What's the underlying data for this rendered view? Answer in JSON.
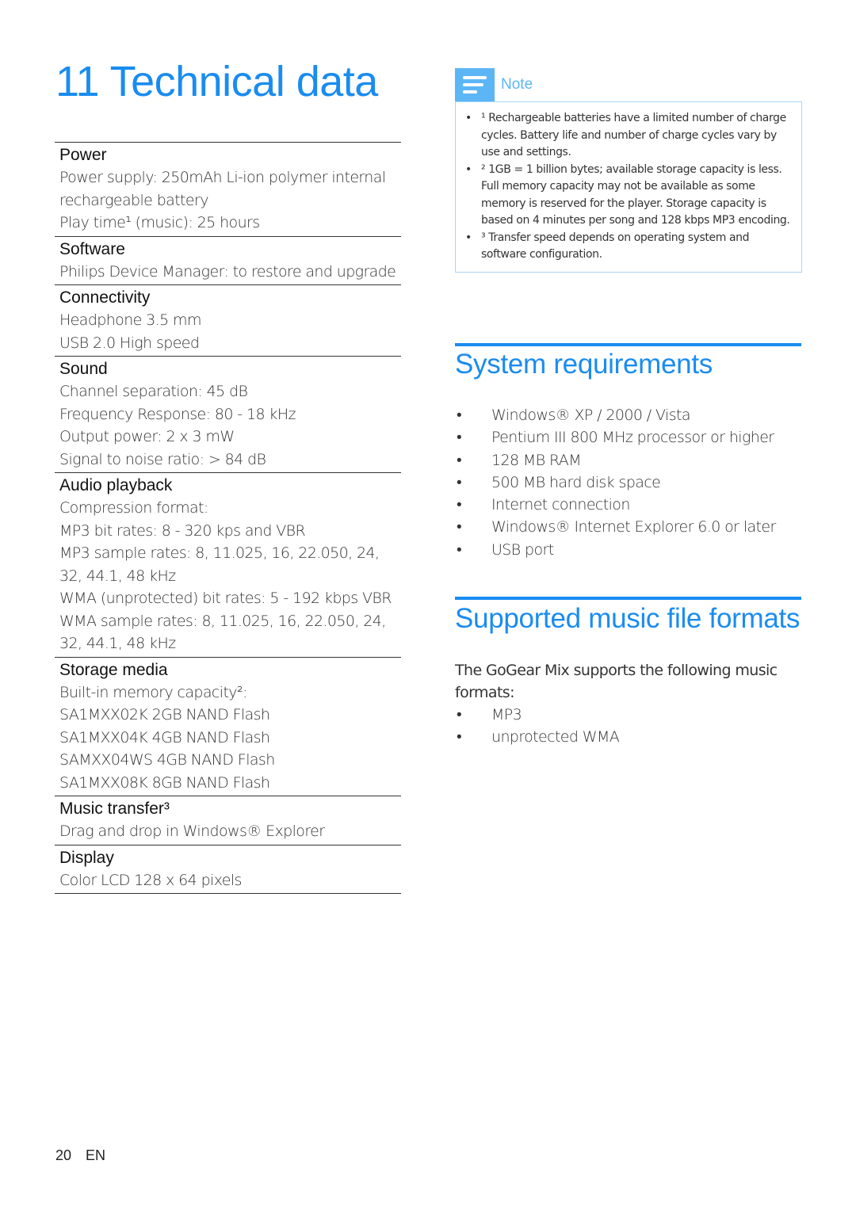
{
  "page_title": "11 Technical data",
  "specs": [
    {
      "heading": "Power",
      "lines": [
        "Power supply: 250mAh Li-ion polymer internal rechargeable battery",
        "Play time¹ (music): 25 hours"
      ]
    },
    {
      "heading": "Software",
      "lines": [
        "Philips Device Manager: to restore and upgrade"
      ]
    },
    {
      "heading": "Connectivity",
      "lines": [
        "Headphone 3.5 mm",
        "USB 2.0 High speed"
      ]
    },
    {
      "heading": "Sound",
      "lines": [
        "Channel separation: 45 dB",
        "Frequency Response: 80 - 18 kHz",
        "Output power: 2 x 3 mW",
        "Signal to noise ratio: > 84 dB"
      ]
    },
    {
      "heading": "Audio playback",
      "lines": [
        "Compression format:",
        "MP3 bit rates: 8 - 320 kps and VBR",
        "MP3 sample rates: 8, 11.025, 16, 22.050, 24, 32, 44.1, 48 kHz",
        "WMA (unprotected) bit rates: 5 - 192 kbps VBR",
        "WMA sample rates: 8, 11.025, 16, 22.050, 24, 32, 44.1, 48 kHz"
      ]
    },
    {
      "heading": "Storage media",
      "lines": [
        "Built-in memory capacity²:",
        "SA1MXX02K 2GB NAND Flash",
        "SA1MXX04K 4GB NAND Flash",
        "SAMXX04WS 4GB NAND Flash",
        "SA1MXX08K 8GB NAND Flash"
      ]
    },
    {
      "heading": "Music transfer³",
      "lines": [
        "Drag and drop in Windows® Explorer"
      ]
    },
    {
      "heading": "Display",
      "lines": [
        "Color LCD 128 x 64 pixels"
      ]
    }
  ],
  "note": {
    "label": "Note",
    "icon": "note-lines-icon",
    "items": [
      "¹ Rechargeable batteries have a limited number of charge cycles. Battery life and number of charge cycles vary by use and settings.",
      "² 1GB = 1 billion bytes; available storage capacity is less. Full memory capacity may not be available as some memory is reserved for the player. Storage capacity is based on 4 minutes per song and 128 kbps MP3 encoding.",
      "³ Transfer speed depends on operating system and software configuration."
    ]
  },
  "system_requirements": {
    "title": "System requirements",
    "items": [
      "Windows® XP / 2000 / Vista",
      "Pentium III 800 MHz processor or higher",
      "128 MB RAM",
      "500 MB hard disk space",
      "Internet connection",
      "Windows® Internet Explorer 6.0 or later",
      "USB port"
    ]
  },
  "music_formats": {
    "title": "Supported music file formats",
    "intro": "The GoGear Mix supports the following music formats:",
    "items": [
      "MP3",
      "unprotected WMA"
    ]
  },
  "footer": {
    "page_number": "20",
    "language": "EN"
  },
  "bullet_char": "•",
  "colors": {
    "accent": "#1a8cf0",
    "note_accent": "#5cb6f5",
    "note_border": "#a9d6f8"
  }
}
